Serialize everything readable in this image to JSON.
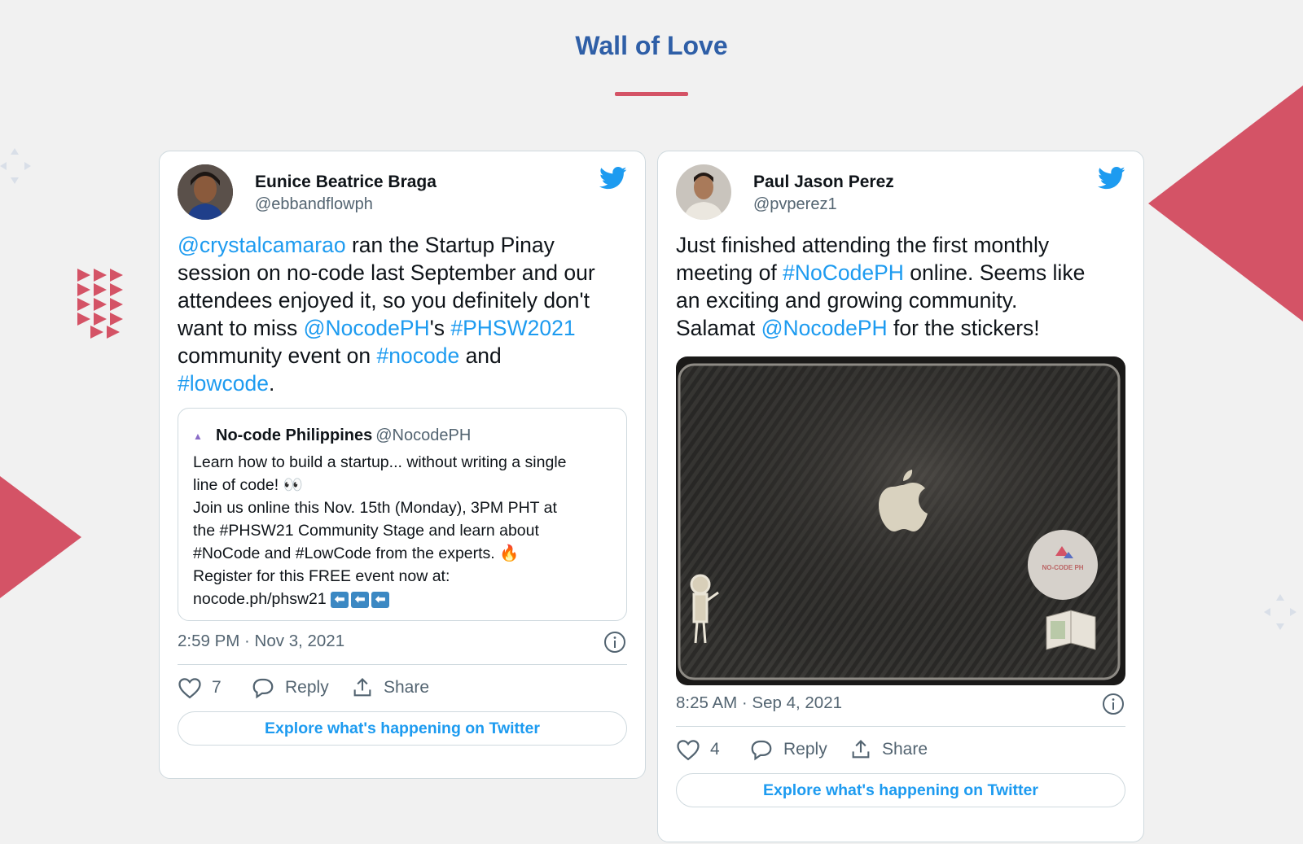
{
  "page": {
    "title": "Wall of Love",
    "accent_color": "#d45366",
    "title_color": "#2f5fa7"
  },
  "tweets": [
    {
      "author_name": "Eunice Beatrice Braga",
      "author_handle": "@ebbandflowph",
      "text_lines": [
        [
          {
            "t": "@crystalcamarao",
            "link": true
          },
          {
            "t": " ran the Startup Pinay"
          }
        ],
        [
          {
            "t": "session on no-code last September and our"
          }
        ],
        [
          {
            "t": "attendees enjoyed it, so you definitely don't"
          }
        ],
        [
          {
            "t": "want to miss "
          },
          {
            "t": "@NocodePH",
            "link": true
          },
          {
            "t": "'s "
          },
          {
            "t": "#PHSW2021",
            "link": true
          }
        ],
        [
          {
            "t": "community event on "
          },
          {
            "t": "#nocode",
            "link": true
          },
          {
            "t": " and"
          }
        ],
        [
          {
            "t": "#lowcode",
            "link": true
          },
          {
            "t": "."
          }
        ]
      ],
      "quote": {
        "name": "No-code Philippines",
        "handle": "@NocodePH",
        "lines": [
          "Learn how to build a startup... without writing a single",
          "line of code!  👀",
          "Join us online this Nov. 15th (Monday), 3PM PHT at",
          "the #PHSW21 Community Stage and learn about",
          "#NoCode and #LowCode from the experts. 🔥",
          "Register for this FREE event now at:",
          "nocode.ph/phsw21"
        ],
        "arrows": [
          "⬅",
          "⬅",
          "⬅"
        ]
      },
      "timestamp": "2:59 PM · Nov 3, 2021",
      "likes": "7",
      "reply_label": "Reply",
      "share_label": "Share",
      "explore_label": "Explore what's happening on Twitter"
    },
    {
      "author_name": "Paul Jason Perez",
      "author_handle": "@pvperez1",
      "text_lines": [
        [
          {
            "t": "Just finished attending the first monthly"
          }
        ],
        [
          {
            "t": "meeting of "
          },
          {
            "t": "#NoCodePH",
            "link": true
          },
          {
            "t": " online. Seems like"
          }
        ],
        [
          {
            "t": "an exciting and growing community."
          }
        ],
        [
          {
            "t": "Salamat "
          },
          {
            "t": "@NocodePH",
            "link": true
          },
          {
            "t": " for the stickers!"
          }
        ]
      ],
      "photo": {
        "sticker_text": "NO-CODE PH"
      },
      "timestamp": "8:25 AM · Sep 4, 2021",
      "likes": "4",
      "reply_label": "Reply",
      "share_label": "Share",
      "explore_label": "Explore what's happening on Twitter"
    }
  ],
  "icons": [
    "twitter-bird-icon",
    "info-icon",
    "heart-icon",
    "reply-bubble-icon",
    "share-icon"
  ]
}
